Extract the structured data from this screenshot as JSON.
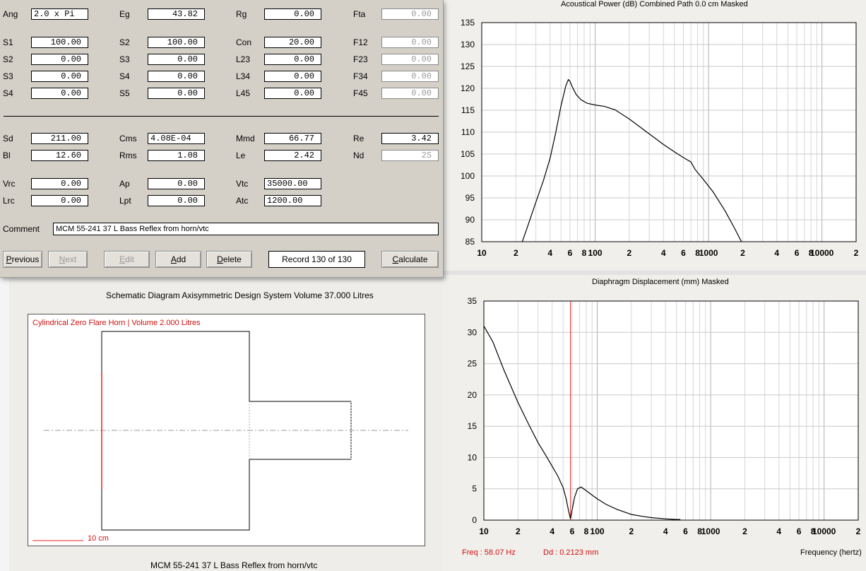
{
  "form": {
    "rows": [
      {
        "label": "Ang",
        "value": "2.0 x Pi",
        "align": "left"
      },
      {
        "label": "Eg",
        "value": "43.82"
      },
      {
        "label": "Rg",
        "value": "0.00"
      },
      {
        "label": "Fta",
        "value": "0.00",
        "disabled": true
      },
      {
        "label": "S1",
        "value": "100.00"
      },
      {
        "label": "S2",
        "value": "100.00"
      },
      {
        "label": "Con",
        "value": "20.00"
      },
      {
        "label": "F12",
        "value": "0.00",
        "disabled": true
      },
      {
        "label": "S2",
        "value": "0.00"
      },
      {
        "label": "S3",
        "value": "0.00"
      },
      {
        "label": "L23",
        "value": "0.00"
      },
      {
        "label": "F23",
        "value": "0.00",
        "disabled": true
      },
      {
        "label": "S3",
        "value": "0.00"
      },
      {
        "label": "S4",
        "value": "0.00"
      },
      {
        "label": "L34",
        "value": "0.00"
      },
      {
        "label": "F34",
        "value": "0.00",
        "disabled": true
      },
      {
        "label": "S4",
        "value": "0.00"
      },
      {
        "label": "S5",
        "value": "0.00"
      },
      {
        "label": "L45",
        "value": "0.00"
      },
      {
        "label": "F45",
        "value": "0.00",
        "disabled": true
      },
      {
        "label": "Sd",
        "value": "211.00"
      },
      {
        "label": "Cms",
        "value": "4.08E-04",
        "align": "left"
      },
      {
        "label": "Mmd",
        "value": "66.77"
      },
      {
        "label": "Re",
        "value": "3.42"
      },
      {
        "label": "Bl",
        "value": "12.60"
      },
      {
        "label": "Rms",
        "value": "1.08"
      },
      {
        "label": "Le",
        "value": "2.42"
      },
      {
        "label": "Nd",
        "value": "2S",
        "disabled": true
      },
      {
        "label": "Vrc",
        "value": "0.00"
      },
      {
        "label": "Ap",
        "value": "0.00"
      },
      {
        "label": "Vtc",
        "value": "35000.00",
        "align": "left"
      },
      {
        "label": "Lrc",
        "value": "0.00"
      },
      {
        "label": "Lpt",
        "value": "0.00"
      },
      {
        "label": "Atc",
        "value": "1200.00",
        "align": "left"
      }
    ],
    "comment_label": "Comment",
    "comment_value": "MCM  55-241 37 L Bass Reflex from horn/vtc",
    "buttons": {
      "previous": {
        "first": "P",
        "rest": "revious"
      },
      "next": {
        "first": "N",
        "rest": "ext"
      },
      "edit": {
        "first": "E",
        "rest": "dit"
      },
      "add": {
        "first": "A",
        "rest": "dd"
      },
      "delete": {
        "first": "D",
        "rest": "elete"
      },
      "calculate": {
        "first": "C",
        "rest": "alculate"
      }
    },
    "record_text": "Record 130 of 130"
  },
  "acoustic": {
    "title": "Acoustical Power (dB)   Combined   Path 0.0 cm   Masked"
  },
  "displacement": {
    "title": "Diaphragm Displacement (mm)   Masked",
    "freq_readout": "Freq : 58.07 Hz",
    "dd_readout": "Dd : 0.2123 mm",
    "x_axis_label": "Frequency (hertz)"
  },
  "schematic": {
    "title": "Schematic Diagram   Axisymmetric Design   System Volume 37.000 Litres",
    "inner_label": "Cylindrical Zero Flare Horn | Volume 2.000 Litres",
    "scale_label": "10 cm",
    "footer": "MCM  55-241 37 L Bass Reflex from horn/vtc"
  },
  "chart_data": [
    {
      "type": "line",
      "title": "Acoustical Power (dB)   Combined   Path 0.0 cm   Masked",
      "x_scale": "log",
      "xlim": [
        10,
        20000
      ],
      "ylim": [
        85,
        135
      ],
      "y_ticks": [
        85,
        90,
        95,
        100,
        105,
        110,
        115,
        120,
        125,
        130,
        135
      ],
      "x_tick_labels": [
        "10",
        "2",
        "4",
        "6",
        "8",
        "100",
        "2",
        "4",
        "6",
        "8",
        "1000",
        "2",
        "4",
        "6",
        "8",
        "10000",
        "2"
      ],
      "grid": true,
      "series": [
        {
          "color": "#000000",
          "x": [
            22.7,
            25,
            30,
            35,
            40,
            45,
            50,
            55,
            58,
            60,
            63,
            68,
            75,
            85,
            100,
            120,
            150,
            200,
            300,
            400,
            500,
            600,
            700,
            720,
            760,
            900,
            1100,
            1400,
            1700,
            1950
          ],
          "y": [
            84.9,
            88,
            94,
            99,
            104,
            110,
            116,
            120.5,
            122,
            121.6,
            120.3,
            118.6,
            117.4,
            116.6,
            116.2,
            115.9,
            115.1,
            113,
            109.6,
            107.2,
            105.5,
            104.2,
            103.2,
            102.6,
            101.5,
            99.2,
            96.3,
            92,
            88,
            85
          ]
        }
      ]
    },
    {
      "type": "line",
      "title": "Diaphragm Displacement (mm)   Masked",
      "x_scale": "log",
      "xlim": [
        10,
        20000
      ],
      "ylim": [
        0,
        35
      ],
      "y_ticks": [
        0,
        5,
        10,
        15,
        20,
        25,
        30,
        35
      ],
      "x_tick_labels": [
        "10",
        "2",
        "4",
        "6",
        "8",
        "100",
        "2",
        "4",
        "6",
        "8",
        "1000",
        "2",
        "4",
        "6",
        "8",
        "10000",
        "2"
      ],
      "xlabel": "Frequency (hertz)",
      "grid": true,
      "cursor_x": 58.07,
      "series": [
        {
          "color": "#000000",
          "x": [
            10,
            12,
            15,
            20,
            25,
            30,
            35,
            40,
            45,
            50,
            53,
            56,
            58,
            60,
            63,
            67,
            72,
            80,
            90,
            100,
            120,
            150,
            200,
            250,
            300,
            400,
            500,
            540
          ],
          "y": [
            31,
            28.5,
            24,
            18.8,
            15.2,
            12.4,
            10.4,
            8.6,
            7,
            5.2,
            3.5,
            1.4,
            0.2,
            1.6,
            3.6,
            5,
            5.3,
            4.7,
            4,
            3.4,
            2.5,
            1.7,
            0.9,
            0.6,
            0.4,
            0.2,
            0.1,
            0.1
          ]
        }
      ]
    }
  ]
}
